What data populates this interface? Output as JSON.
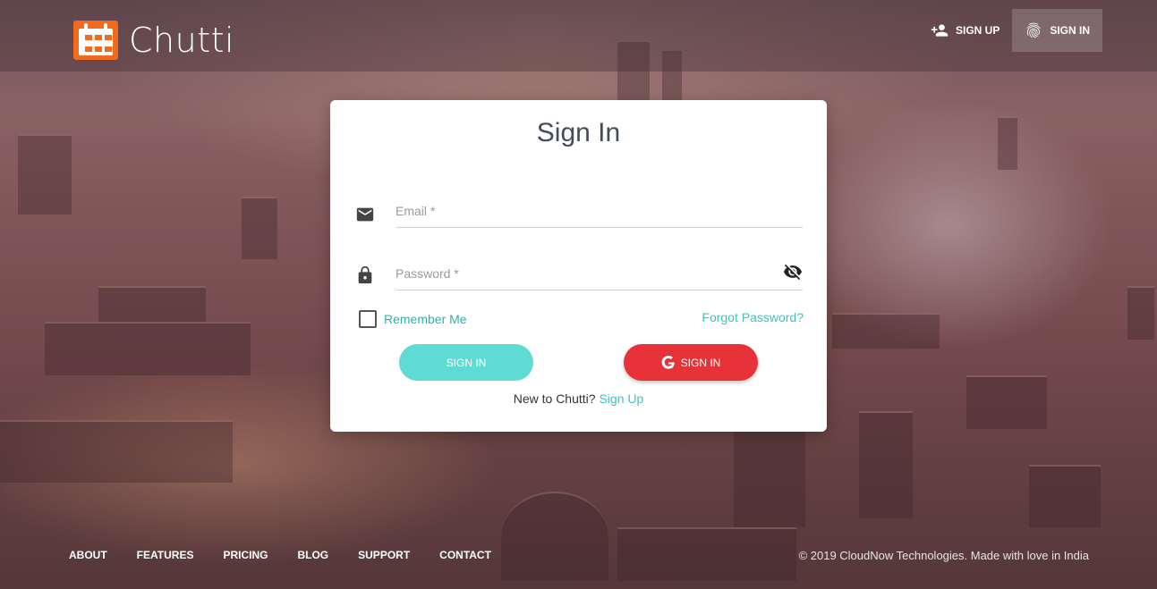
{
  "brand": {
    "name": "Chutti",
    "accent": "#f26b1d"
  },
  "header": {
    "signup_label": "SIGN UP",
    "signin_label": "SIGN IN",
    "signup_icon": "person-add-icon",
    "signin_icon": "fingerprint-icon"
  },
  "form": {
    "title": "Sign In",
    "email_placeholder": "Email *",
    "email_value": "",
    "email_icon": "mail-icon",
    "password_placeholder": "Password *",
    "password_value": "",
    "password_icon": "lock-icon",
    "visibility_icon": "eye-off-icon",
    "remember_label": "Remember Me",
    "remember_checked": false,
    "forgot_label": "Forgot Password?",
    "signin_button": "SIGN IN",
    "google_button": "SIGN IN",
    "google_icon": "google-icon",
    "new_text": "New to Chutti?",
    "signup_link": "Sign Up"
  },
  "colors": {
    "teal_button": "#5edcd3",
    "teal_text": "#3cc4be",
    "google_red": "#e8323a"
  },
  "footer": {
    "links": [
      "ABOUT",
      "FEATURES",
      "PRICING",
      "BLOG",
      "SUPPORT",
      "CONTACT"
    ],
    "copyright": "© 2019 CloudNow Technologies. Made with love in India"
  }
}
